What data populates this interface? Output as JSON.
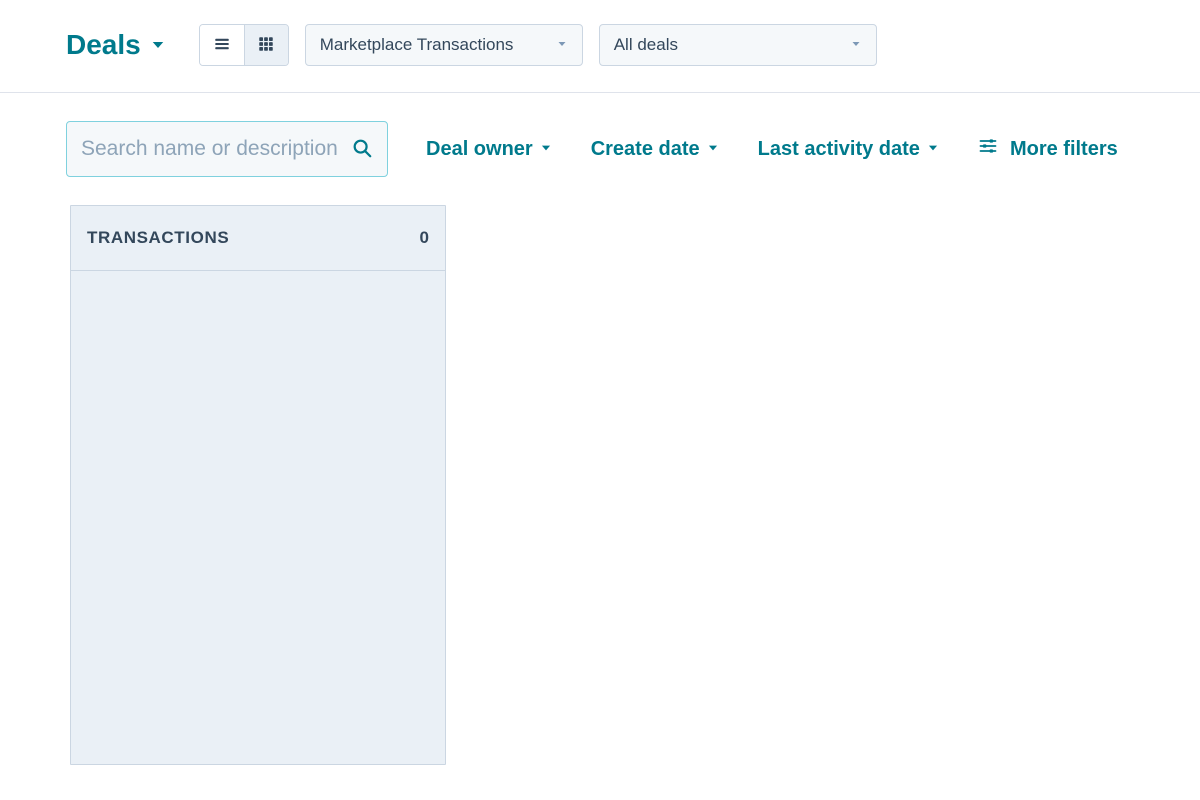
{
  "header": {
    "title": "Deals",
    "pipeline_selected": "Marketplace Transactions",
    "filter_selected": "All deals"
  },
  "search": {
    "placeholder": "Search name or description"
  },
  "filters": {
    "owner_label": "Deal owner",
    "create_date_label": "Create date",
    "last_activity_label": "Last activity date",
    "more_filters_label": "More filters"
  },
  "board": {
    "columns": [
      {
        "title": "TRANSACTIONS",
        "count": "0"
      }
    ]
  }
}
